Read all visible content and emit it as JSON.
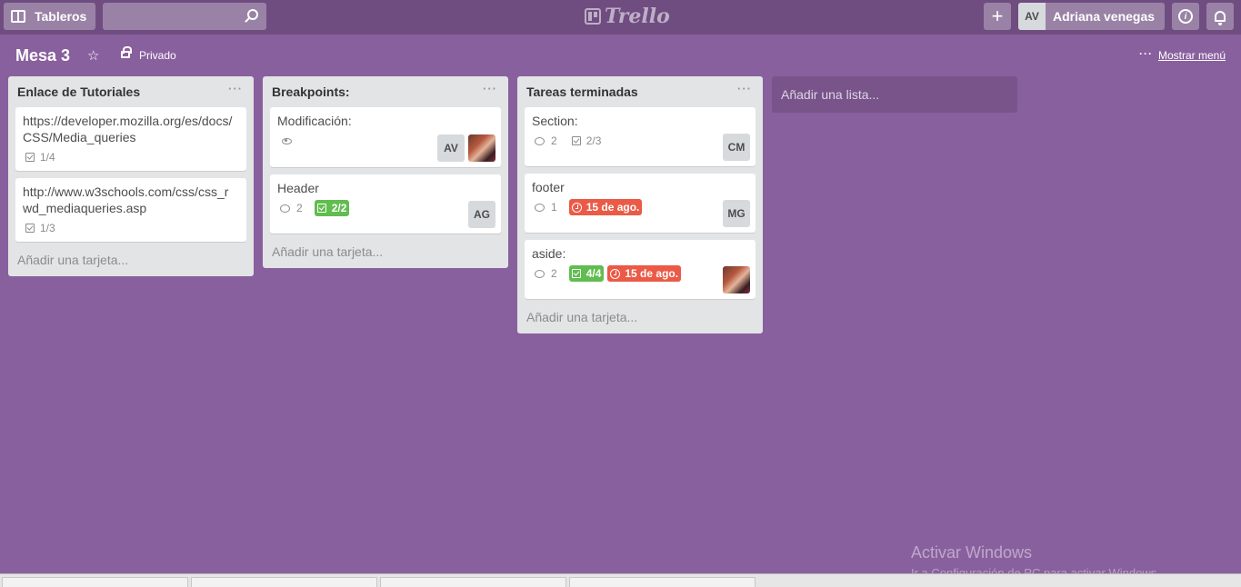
{
  "header": {
    "boards_label": "Tableros",
    "search_placeholder": "",
    "logo_text": "Trello",
    "add_icon_text": "+",
    "user_initials": "AV",
    "user_name": "Adriana venegas",
    "info_icon_text": "i"
  },
  "board": {
    "title": "Mesa 3",
    "star_icon_text": "☆",
    "privacy": "Privado",
    "menu_dots": "···",
    "show_menu": "Mostrar menú"
  },
  "lists": [
    {
      "title": "Enlace de Tutoriales",
      "menu": "···",
      "add_card": "Añadir una tarjeta...",
      "cards": [
        {
          "title": "https://developer.mozilla.org/es/docs/CSS/Media_queries",
          "checklist": "1/4"
        },
        {
          "title": "http://www.w3schools.com/css/css_rwd_mediaqueries.asp",
          "checklist": "1/3"
        }
      ]
    },
    {
      "title": "Breakpoints:",
      "menu": "···",
      "add_card": "Añadir una tarjeta...",
      "cards": [
        {
          "title": "Modificación:",
          "members": [
            "AV"
          ]
        },
        {
          "title": "Header",
          "comments": "2",
          "checklist": "2/2",
          "members": [
            "AG"
          ]
        }
      ]
    },
    {
      "title": "Tareas terminadas",
      "menu": "···",
      "add_card": "Añadir una tarjeta...",
      "cards": [
        {
          "title": "Section:",
          "comments": "2",
          "checklist": "2/3",
          "members": [
            "CM"
          ]
        },
        {
          "title": "footer",
          "comments": "1",
          "due": "15 de ago.",
          "members": [
            "MG"
          ]
        },
        {
          "title": "aside:",
          "comments": "2",
          "checklist": "4/4",
          "due": "15 de ago."
        }
      ]
    }
  ],
  "add_list": "Añadir una lista...",
  "watermark": {
    "line1": "Activar Windows",
    "line2": "Ir a Configuración de PC para activar Windows."
  },
  "colors": {
    "board_bg": "#89609e",
    "header_bg": "#6f4d80",
    "label_green": "#61bd4f",
    "label_red": "#eb5a46"
  }
}
